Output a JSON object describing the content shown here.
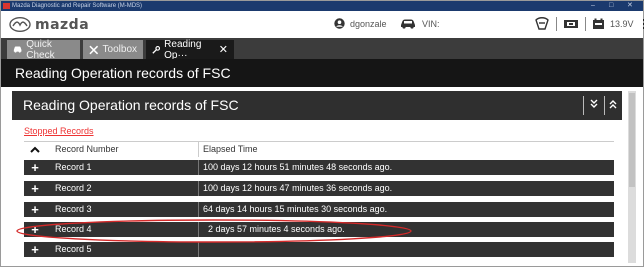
{
  "window": {
    "title": "Mazda Diagnostic and Repair Software (M-MDS)",
    "minimize": "–",
    "maximize": "□",
    "close": "✕"
  },
  "brand": {
    "logo_text": "mazda",
    "username": "dgonzale",
    "vin_label": "VIN:",
    "voltage": "13.9V"
  },
  "tabs": [
    {
      "label": "Quick Check",
      "icon": "car-icon",
      "active": false
    },
    {
      "label": "Toolbox",
      "icon": "tools-icon",
      "active": false
    },
    {
      "label": "Reading Op···",
      "icon": "wrench-icon",
      "active": true,
      "close": "✕"
    }
  ],
  "page": {
    "title": "Reading Operation records of FSC"
  },
  "section": {
    "title": "Reading Operation records of FSC",
    "expand_icon": "double-chevron-down-icon",
    "collapse_icon": "double-chevron-up-icon"
  },
  "stopped_records_label": "Stopped Records",
  "table": {
    "sort_icon": "chevron-up-icon",
    "columns": [
      "Record Number",
      "Elapsed Time"
    ],
    "rows": [
      {
        "record": "Record 1",
        "elapsed": "100 days 12 hours 51 minutes 48 seconds ago."
      },
      {
        "record": "Record 2",
        "elapsed": "100 days 12 hours 47 minutes 36 seconds ago."
      },
      {
        "record": "Record 3",
        "elapsed": "64 days 14 hours 15 minutes 30 seconds ago."
      },
      {
        "record": "Record 4",
        "elapsed": "2 days 57 minutes 4 seconds ago."
      },
      {
        "record": "Record 5",
        "elapsed": ""
      }
    ],
    "expand_symbol": "+"
  },
  "annotation_color": "#d42a2a"
}
